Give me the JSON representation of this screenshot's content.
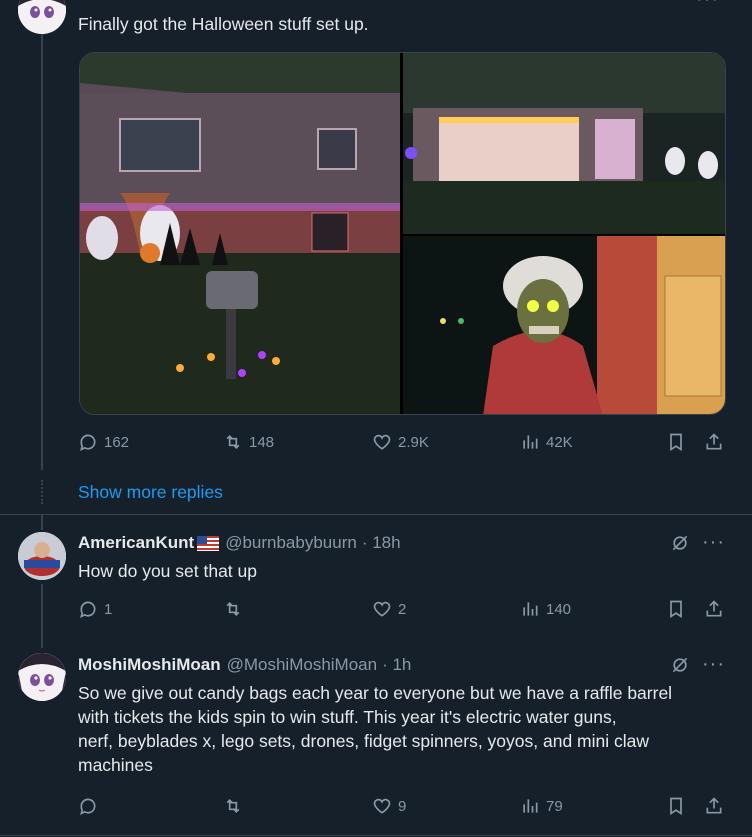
{
  "tweet1": {
    "text": "Finally got the Halloween stuff set up.",
    "actions": {
      "replies": "162",
      "retweets": "148",
      "likes": "2.9K",
      "views": "42K"
    }
  },
  "show_more": "Show more replies",
  "reply1": {
    "name": "AmericanKunt",
    "handle": "@burnbabybuurn",
    "time": "· 18h",
    "text": "How do you set that up",
    "actions": {
      "replies": "1",
      "retweets": "",
      "likes": "2",
      "views": "140"
    }
  },
  "reply2": {
    "name": "MoshiMoshiMoan",
    "handle": "@MoshiMoshiMoan",
    "time": "· 1h",
    "text_lines": [
      "So we give out candy bags each year to everyone but we have a raffle barrel",
      "with tickets the kids spin to win stuff.  This year it's electric water guns,",
      "nerf, beyblades x, lego sets, drones, fidget spinners, yoyos, and mini claw",
      "machines"
    ],
    "actions": {
      "replies": "",
      "retweets": "",
      "likes": "9",
      "views": "79"
    }
  },
  "more_glyph": "···",
  "colors": {
    "background": "#15202b",
    "link": "#1d9bf0",
    "muted": "#8b98a5",
    "text": "#e7e9ea"
  }
}
